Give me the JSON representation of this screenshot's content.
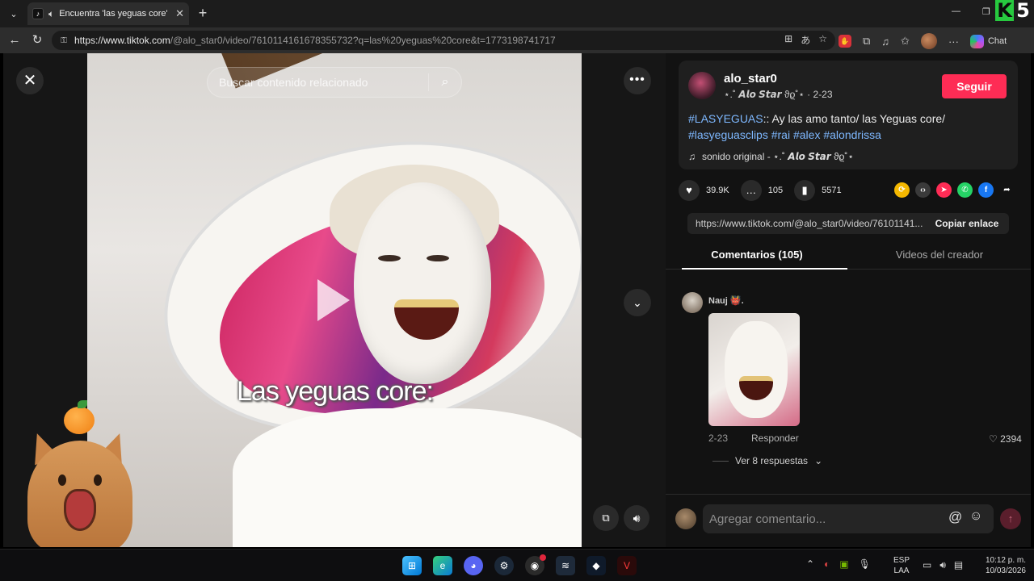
{
  "browser": {
    "tab": {
      "title": "Encuentra 'las yeguas core' en",
      "favicon": "tiktok-icon",
      "audio_icon": "speaker-icon"
    },
    "url": {
      "host": "https://www.tiktok.com",
      "path": "/@alo_star0/video/7610114161678355732?q=las%20yeguas%20core&t=1773198741717"
    },
    "copilot_label": "Chat",
    "corner_logo": {
      "k": "K",
      "five": "5"
    }
  },
  "video": {
    "search_placeholder": "Buscar contenido relacionado",
    "caption_overlay": "Las yeguas core:"
  },
  "post": {
    "username": "alo_star0",
    "meta_prefix": "⋆.˚",
    "display_name": "𝘼𝙡𝙤 𝙎𝙩𝙖𝙧",
    "meta_suffix": "ϑϱ˚⋆ · 2-23",
    "follow_label": "Seguir",
    "description_tag1": "#LASYEGUAS",
    "description_text": ":: Ay las amo tanto/ las Yeguas core/",
    "tags": [
      "#lasyeguasclips",
      "#rai",
      "#alex",
      "#alondrissa"
    ],
    "music_prefix": "sonido original - ⋆.˚",
    "music_name": "𝘼𝙡𝙤 𝙎𝙩𝙖𝙧",
    "music_suffix": "ϑϱ˚⋆",
    "likes": "39.9K",
    "comments": "105",
    "saves": "5571",
    "link": "https://www.tiktok.com/@alo_star0/video/76101141...",
    "copy_link_label": "Copiar enlace"
  },
  "tabs": {
    "comments_label": "Comentarios (105)",
    "creator_videos_label": "Videos del creador"
  },
  "comment": {
    "user": "Nauj 👹.",
    "date": "2-23",
    "reply_label": "Responder",
    "likes": "2394",
    "view_replies": "Ver 8 respuestas"
  },
  "comment_input": {
    "placeholder": "Agregar comentario..."
  },
  "taskbar": {
    "lang_top": "ESP",
    "lang_bottom": "LAA",
    "time": "10:12 p. m.",
    "date": "10/03/2026"
  },
  "colors": {
    "follow": "#fe2c55",
    "hashtag": "#7eb8ff",
    "page_bg": "#121212"
  }
}
